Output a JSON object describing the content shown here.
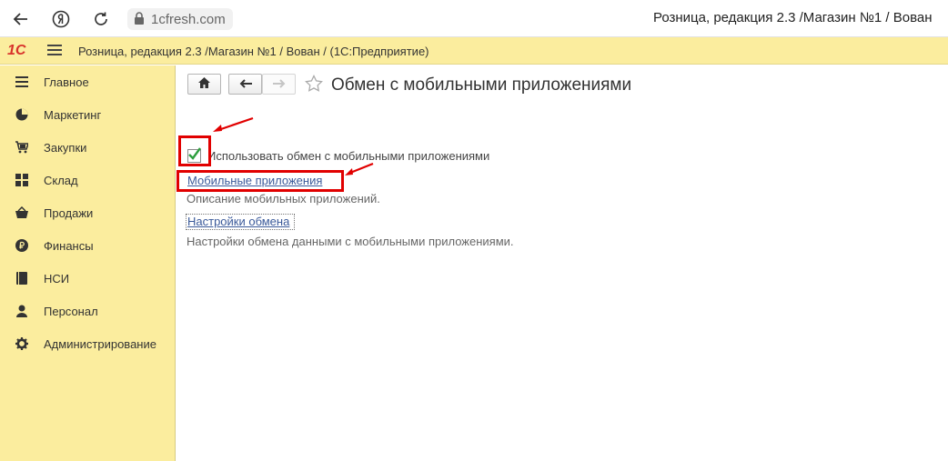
{
  "browser": {
    "url": "1cfresh.com",
    "tab_title": "Розница, редакция 2.3 /Магазин №1 / Вован"
  },
  "app": {
    "title": "Розница, редакция 2.3 /Магазин №1 / Вован /  (1С:Предприятие)",
    "logo_text": "1С"
  },
  "sidebar": {
    "items": [
      {
        "label": "Главное",
        "icon": "list-icon"
      },
      {
        "label": "Маркетинг",
        "icon": "pie-chart-icon"
      },
      {
        "label": "Закупки",
        "icon": "cart-grid-icon"
      },
      {
        "label": "Склад",
        "icon": "warehouse-grid-icon"
      },
      {
        "label": "Продажи",
        "icon": "basket-icon"
      },
      {
        "label": "Финансы",
        "icon": "ruble-icon"
      },
      {
        "label": "НСИ",
        "icon": "book-icon"
      },
      {
        "label": "Персонал",
        "icon": "person-icon"
      },
      {
        "label": "Администрирование",
        "icon": "gear-icon"
      }
    ]
  },
  "main": {
    "title": "Обмен с мобильными приложениями",
    "checkbox": {
      "label": "Использовать обмен с мобильными приложениями",
      "checked": true
    },
    "links": [
      {
        "label": "Мобильные приложения",
        "description": "Описание мобильных приложений."
      },
      {
        "label": "Настройки обмена",
        "description": "Настройки обмена данными с мобильными приложениями."
      }
    ]
  },
  "colors": {
    "accent_yellow": "#fbed9e",
    "link": "#3b5a9a",
    "annotation_red": "#e10000",
    "check_green": "#2e9e3e"
  }
}
